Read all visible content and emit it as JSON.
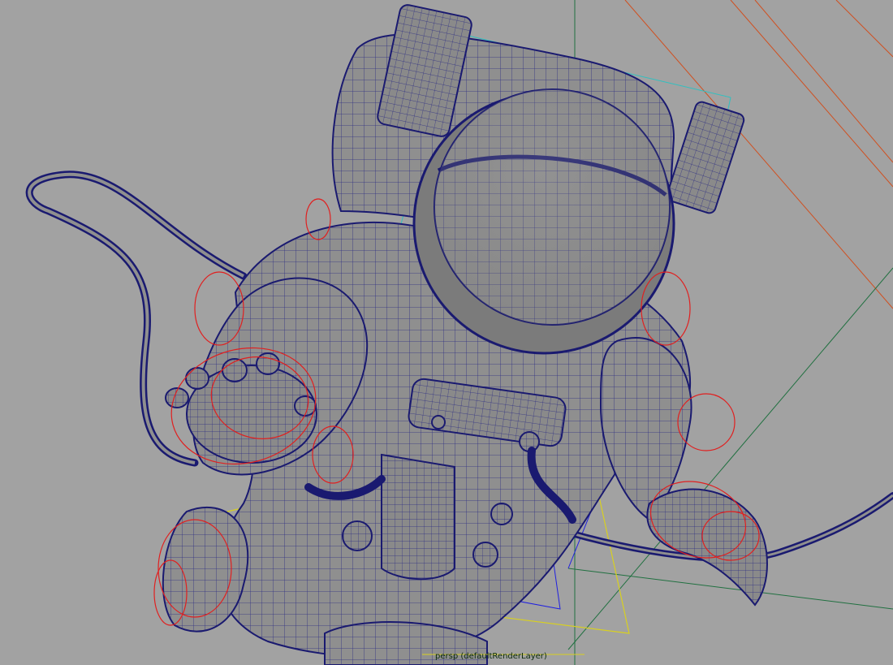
{
  "viewport": {
    "camera": "persp",
    "render_layer": "defaultRenderLayer",
    "label": "persp (defaultRenderLayer)",
    "background_color": "#a2a2a2"
  },
  "scene": {
    "subject": "astronaut-wireframe-model",
    "colors": {
      "mesh_fill": "#8e8e8e",
      "wireframe": "#1a1a7a",
      "control_curve": "#e02020",
      "ik_lines": "#2020e0",
      "selection_cyan": "#30c0c0",
      "light_orange": "#d05020",
      "grid_green": "#207040",
      "bounding_yellow": "#d8d020"
    }
  }
}
